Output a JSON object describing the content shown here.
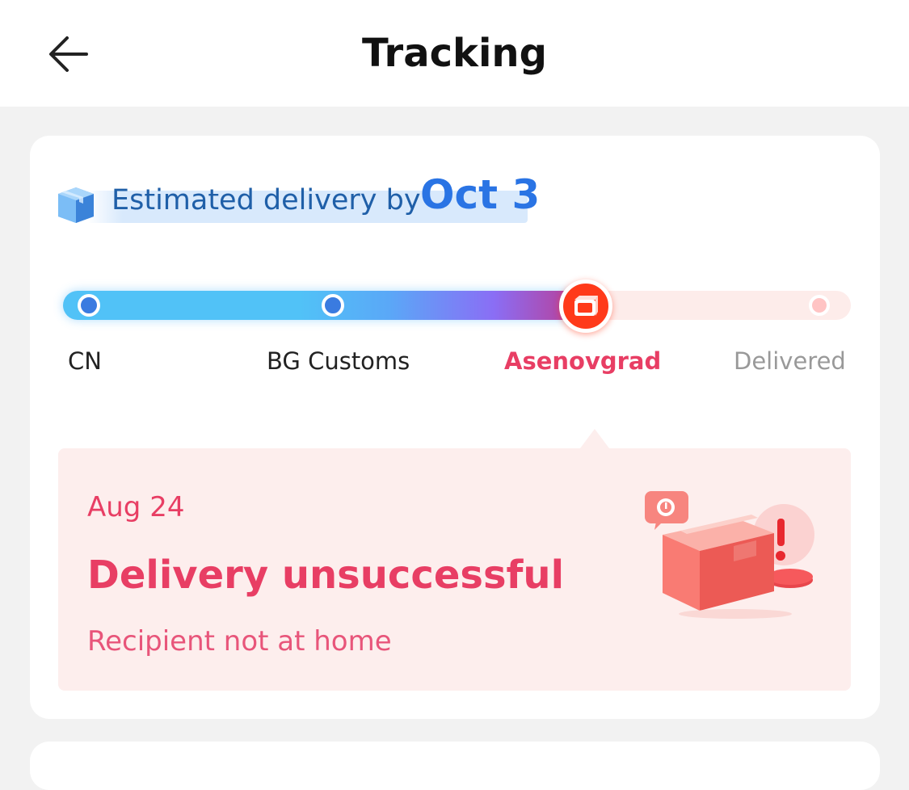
{
  "header": {
    "title": "Tracking",
    "back_icon": "arrow-left-icon"
  },
  "estimate": {
    "label": "Estimated delivery by",
    "date": "Oct 3",
    "icon": "package-box-icon"
  },
  "progress": {
    "stops": [
      {
        "label": "CN",
        "state": "done"
      },
      {
        "label": "BG Customs",
        "state": "done"
      },
      {
        "label": "Asenovgrad",
        "state": "current"
      },
      {
        "label": "Delivered",
        "state": "future"
      }
    ],
    "current_icon": "package-icon"
  },
  "event": {
    "date": "Aug 24",
    "status": "Delivery unsuccessful",
    "detail": "Recipient not at home",
    "illustration_icon": "package-warning-icon"
  },
  "colors": {
    "accent_blue": "#2a74e4",
    "alert_red": "#e83e64",
    "current_stop": "#ff3a1a"
  }
}
